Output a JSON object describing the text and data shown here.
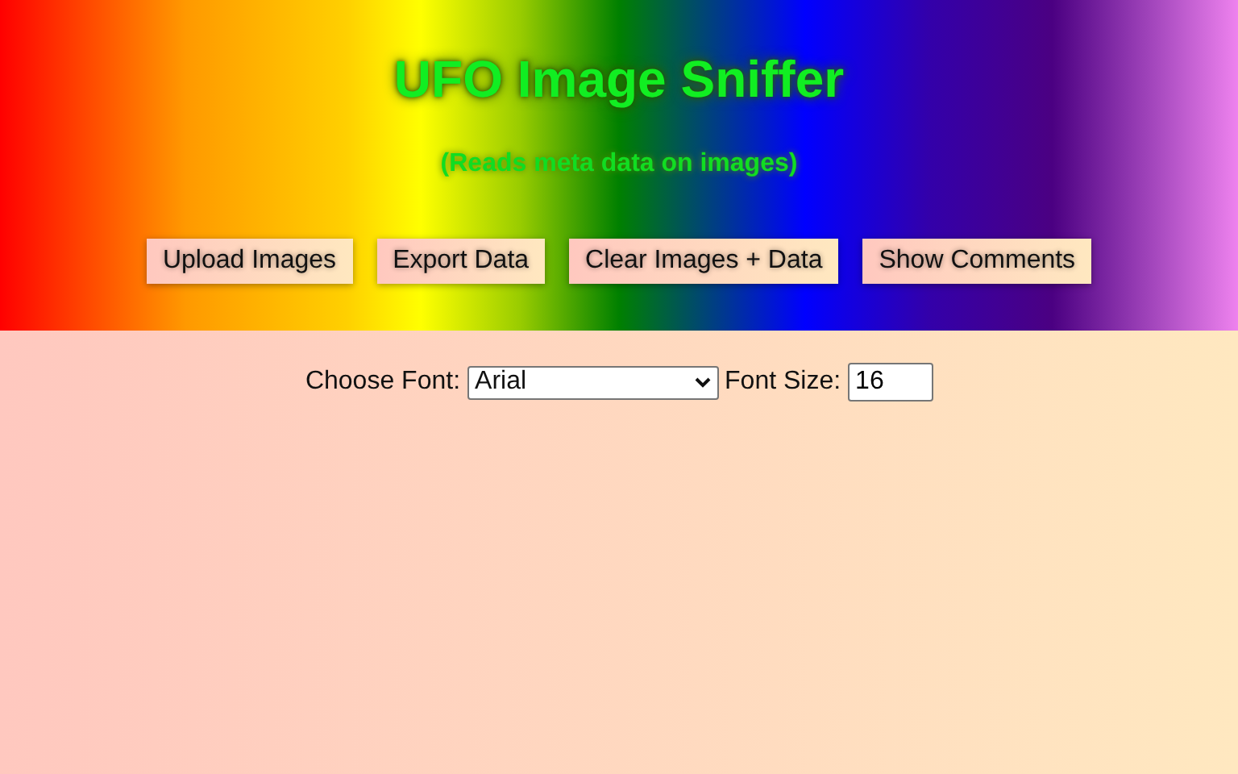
{
  "header": {
    "title": "UFO Image Sniffer",
    "subtitle": "(Reads meta data on images)"
  },
  "buttons": [
    "Upload Images",
    "Export Data",
    "Clear Images + Data",
    "Show Comments"
  ],
  "settings": {
    "font_label": "Choose Font:",
    "font_value": "Arial",
    "size_label": "Font Size:",
    "size_value": "16"
  }
}
